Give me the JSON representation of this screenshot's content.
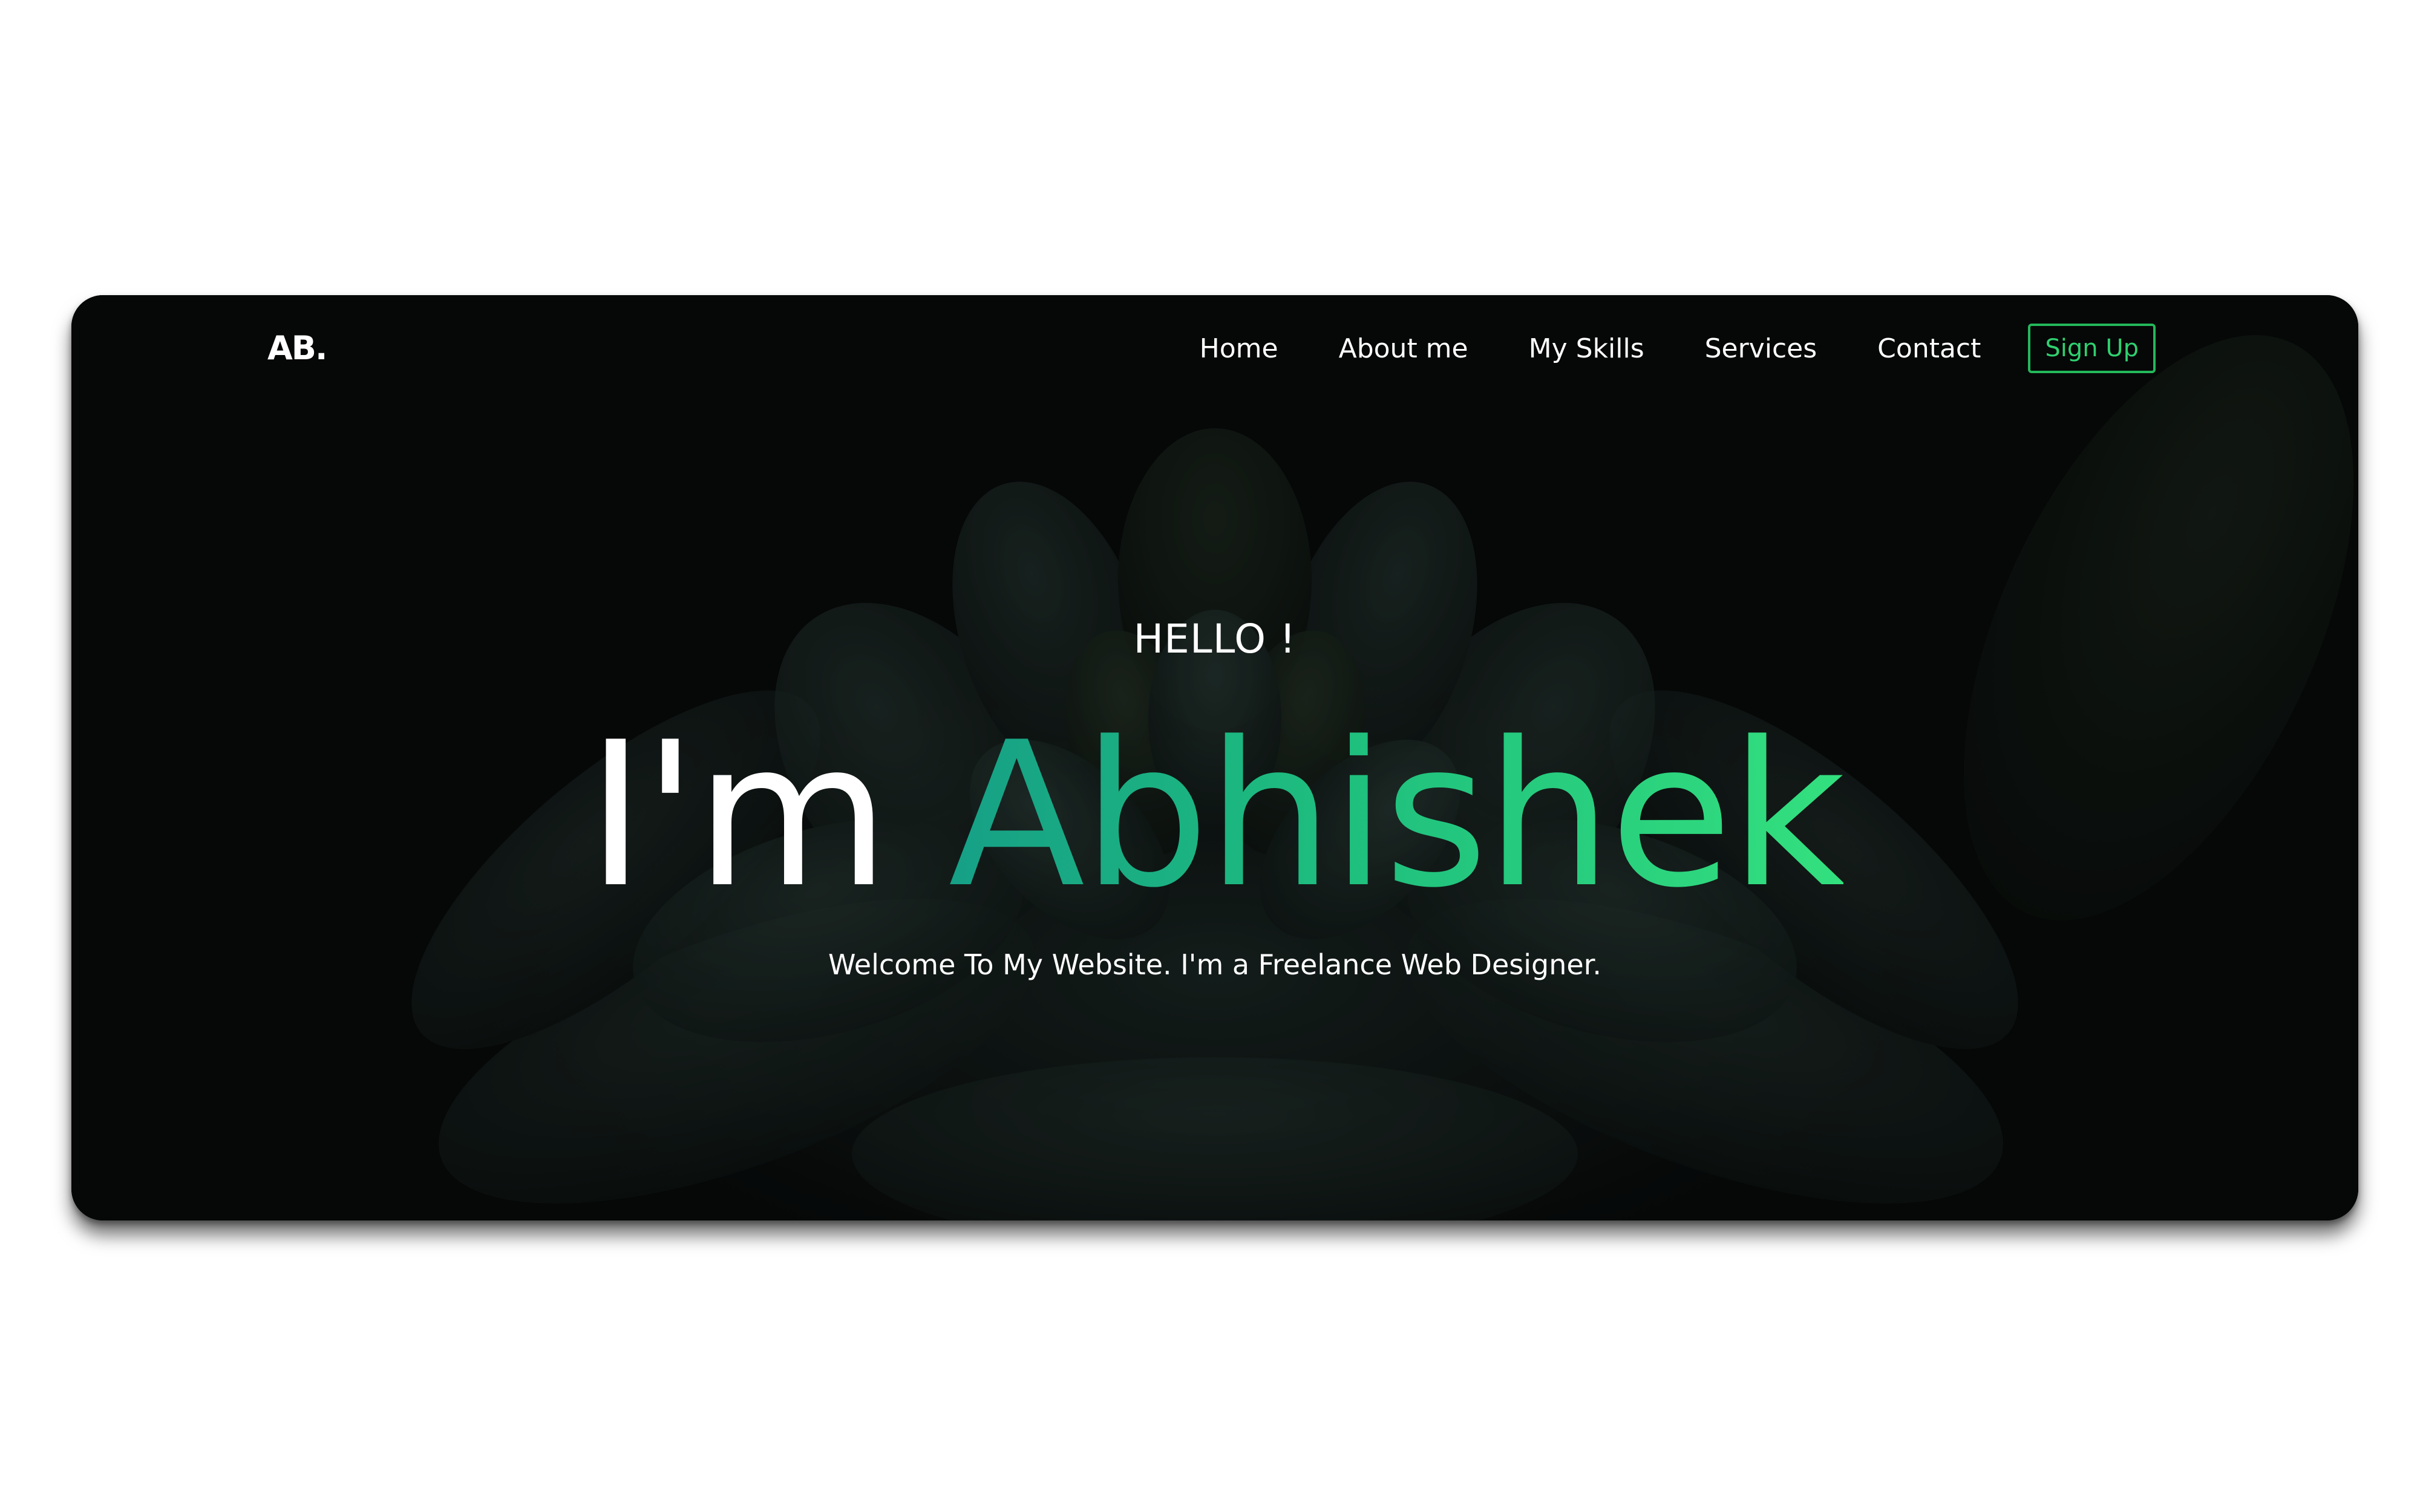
{
  "brand": {
    "logo": "AB."
  },
  "nav": {
    "items": [
      {
        "label": "Home"
      },
      {
        "label": "About me"
      },
      {
        "label": "My Skills"
      },
      {
        "label": "Services"
      },
      {
        "label": "Contact"
      }
    ],
    "cta_label": "Sign Up"
  },
  "hero": {
    "greeting": "HELLO !",
    "headline_prefix": "I'm",
    "headline_name": "Abhishek",
    "tagline": "Welcome To My Website. I'm a Freelance Web Designer."
  },
  "colors": {
    "background": "#080a0a",
    "accent_start": "#16a086",
    "accent_end": "#33e07e",
    "signup_border": "#23b85a"
  }
}
